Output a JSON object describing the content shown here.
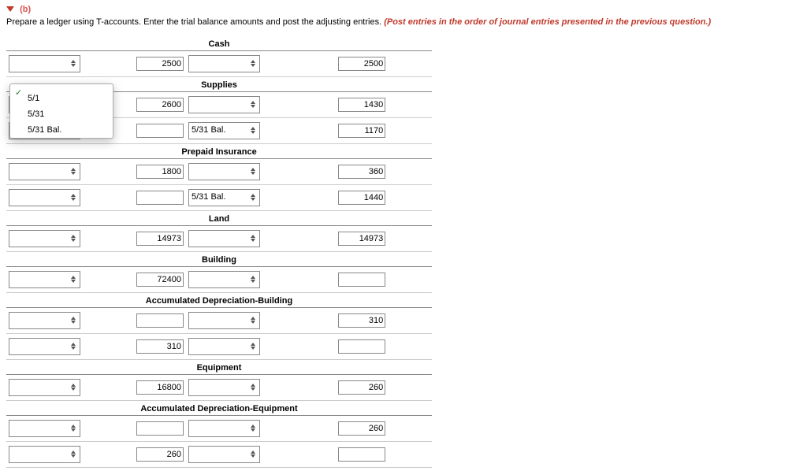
{
  "section_label": "(b)",
  "instruction_plain": "Prepare a ledger using T-accounts. Enter the trial balance amounts and post the adjusting entries. ",
  "instruction_em": "(Post entries in the order of journal entries presented in the previous question.)",
  "dropdown": {
    "check": "✓",
    "items": [
      "",
      "5/1",
      "5/31",
      "5/31 Bal."
    ]
  },
  "accounts": [
    {
      "name": "Cash",
      "rows": [
        {
          "date": "",
          "debit": "2500",
          "mid": "",
          "credit": "2500"
        }
      ]
    },
    {
      "name": "Supplies",
      "rows": [
        {
          "date": "",
          "debit": "2600",
          "mid": "",
          "credit": "1430"
        },
        {
          "date": "",
          "debit": "",
          "mid": "5/31 Bal.",
          "credit": "1170"
        }
      ]
    },
    {
      "name": "Prepaid Insurance",
      "rows": [
        {
          "date": "",
          "debit": "1800",
          "mid": "",
          "credit": "360"
        },
        {
          "date": "",
          "debit": "",
          "mid": "5/31 Bal.",
          "credit": "1440"
        }
      ]
    },
    {
      "name": "Land",
      "rows": [
        {
          "date": "",
          "debit": "14973",
          "mid": "",
          "credit": "14973"
        }
      ]
    },
    {
      "name": "Building",
      "rows": [
        {
          "date": "",
          "debit": "72400",
          "mid": "",
          "credit": ""
        }
      ]
    },
    {
      "name": "Accumulated Depreciation-Building",
      "rows": [
        {
          "date": "",
          "debit": "",
          "mid": "",
          "credit": "310"
        },
        {
          "date": "",
          "debit": "310",
          "mid": "",
          "credit": ""
        }
      ]
    },
    {
      "name": "Equipment",
      "rows": [
        {
          "date": "",
          "debit": "16800",
          "mid": "",
          "credit": "260"
        }
      ]
    },
    {
      "name": "Accumulated Depreciation-Equipment",
      "rows": [
        {
          "date": "",
          "debit": "",
          "mid": "",
          "credit": "260"
        },
        {
          "date": "",
          "debit": "260",
          "mid": "",
          "credit": ""
        }
      ]
    }
  ]
}
